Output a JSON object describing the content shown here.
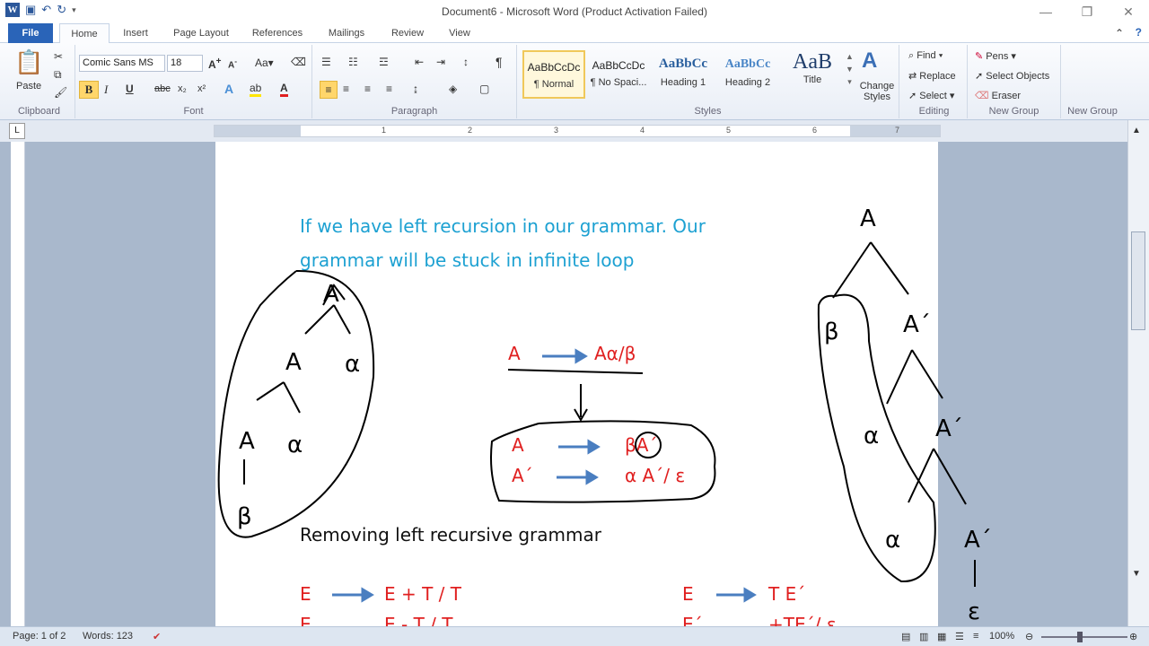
{
  "app": {
    "title": "Document6 - Microsoft Word (Product Activation Failed)"
  },
  "tabs": [
    {
      "label": "File"
    },
    {
      "label": "Home"
    },
    {
      "label": "Insert"
    },
    {
      "label": "Page Layout"
    },
    {
      "label": "References"
    },
    {
      "label": "Mailings"
    },
    {
      "label": "Review"
    },
    {
      "label": "View"
    }
  ],
  "ribbon": {
    "clipboard": {
      "label": "Clipboard",
      "paste": "Paste"
    },
    "font": {
      "label": "Font",
      "name": "Comic Sans MS",
      "size": "18",
      "bold": "B",
      "italic": "I",
      "underline": "U",
      "strike": "abc",
      "sub": "x₂",
      "sup": "x²"
    },
    "paragraph": {
      "label": "Paragraph"
    },
    "styles": {
      "label": "Styles",
      "items": [
        {
          "preview": "AaBbCcDc",
          "name": "¶ Normal"
        },
        {
          "preview": "AaBbCcDc",
          "name": "¶ No Spaci..."
        },
        {
          "preview": "AaBbCc",
          "name": "Heading 1"
        },
        {
          "preview": "AaBbCc",
          "name": "Heading 2"
        },
        {
          "preview": "AaB",
          "name": "Title"
        }
      ],
      "change": "Change Styles"
    },
    "editing": {
      "label": "Editing",
      "find": "Find",
      "replace": "Replace",
      "select": "Select"
    },
    "newgroup1": {
      "label": "New Group",
      "pens": "Pens",
      "select_objects": "Select Objects",
      "eraser": "Eraser"
    },
    "newgroup2": {
      "label": "New Group"
    }
  },
  "ruler": {
    "numbers": [
      "1",
      "2",
      "3",
      "4",
      "5",
      "6",
      "7"
    ]
  },
  "document": {
    "line1": "If we have left recursion in our grammar. Our",
    "line2": "grammar will be stuck in infinite loop",
    "rule1_lhs": "A",
    "rule1_rhs": "Aα/β",
    "rule2_lhs": "A",
    "rule2_rhs": "βA´",
    "rule3_lhs": "A´",
    "rule3_rhs": "α A´/ ε",
    "heading": "Removing left recursive grammar",
    "e1_lhs": "E",
    "e1_rhs": "E + T / T",
    "e2_lhs": "E",
    "e2_rhs": "E - T / T",
    "t1_lhs": "E",
    "t1_rhs": "T E´",
    "t2_lhs": "E´",
    "t2_rhs": "+TE´/ ε"
  },
  "status": {
    "page": "Page: 1 of 2",
    "words": "Words: 123",
    "zoom": "100%"
  }
}
